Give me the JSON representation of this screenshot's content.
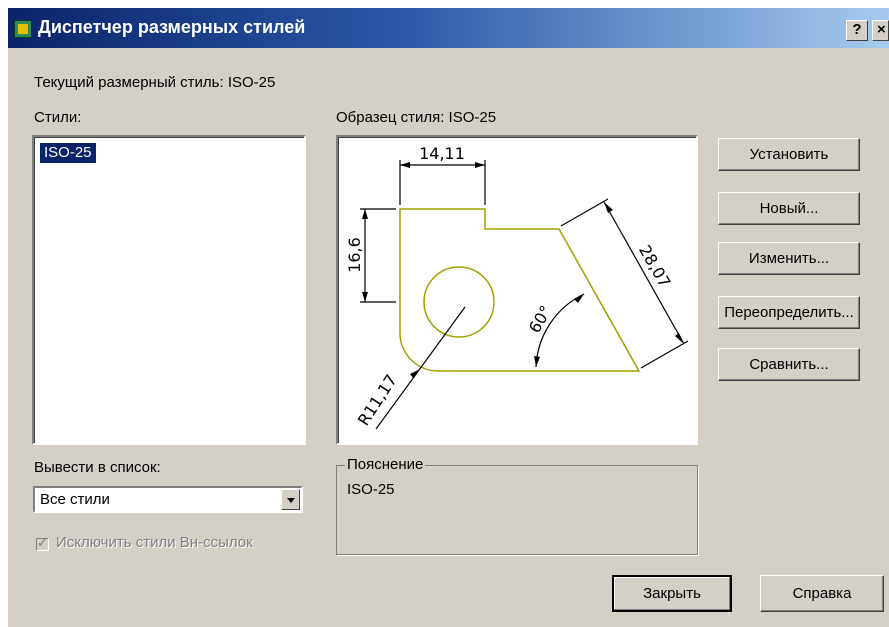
{
  "window": {
    "title": "Диспетчер размерных стилей",
    "help_label": "?",
    "close_label": "×"
  },
  "current_style_label": "Текущий размерный стиль: ISO-25",
  "styles": {
    "label": "Стили:",
    "items": [
      "ISO-25"
    ]
  },
  "preview": {
    "label": "Образец стиля: ISO-25",
    "dims": {
      "top": "14,11",
      "left": "16,6",
      "diagonal": "28,07",
      "angle": "60°",
      "radius": "R11,17"
    },
    "colors": {
      "geometry": "#a0a000",
      "dims": "#000000"
    }
  },
  "buttons": {
    "set": "Установить",
    "new": "Новый...",
    "modify": "Изменить...",
    "override": "Переопределить...",
    "compare": "Сравнить..."
  },
  "list_filter": {
    "label": "Вывести в список:",
    "value": "Все стили"
  },
  "exclude_xref": {
    "label": "Исключить стили Вн-ссылок",
    "checked": true,
    "enabled": false
  },
  "description": {
    "title": "Пояснение",
    "text": "ISO-25"
  },
  "footer": {
    "close": "Закрыть",
    "help": "Справка"
  }
}
